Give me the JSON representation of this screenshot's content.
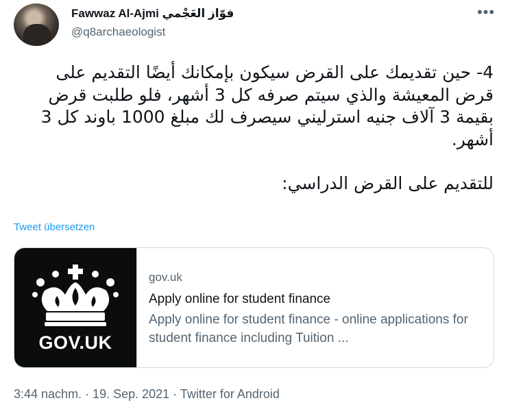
{
  "author": {
    "display_name": "Fawwaz Al-Ajmi فوّاز العَجْمي",
    "handle": "@q8archaeologist"
  },
  "tweet": {
    "paragraph_1": "4- حين تقديمك على القرض سيكون بإمكانك أيضًا التقديم على قرض المعيشة والذي سيتم صرفه كل 3 أشهر، فلو طلبت قرض بقيمة 3 آلاف جنيه استرليني سيصرف لك مبلغ 1000 باوند كل 3 أشهر.",
    "paragraph_2": "للتقديم على القرض الدراسي:",
    "translate_label": "Tweet übersetzen"
  },
  "card": {
    "image_text": "GOV.UK",
    "domain": "gov.uk",
    "title": "Apply online for student finance",
    "description": "Apply online for student finance - online applications for student finance including Tuition ..."
  },
  "meta": {
    "timestamp": "3:44 nachm. · 19. Sep. 2021 · Twitter for Android"
  },
  "icons": {
    "more": "more-options-icon",
    "crown": "crown-logo-icon"
  }
}
